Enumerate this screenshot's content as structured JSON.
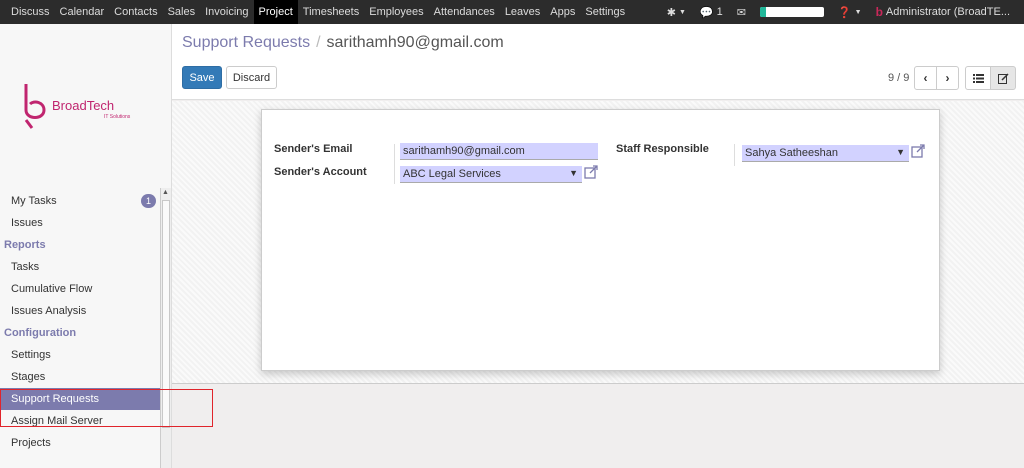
{
  "topbar": {
    "menu": [
      "Discuss",
      "Calendar",
      "Contacts",
      "Sales",
      "Invoicing",
      "Project",
      "Timesheets",
      "Employees",
      "Attendances",
      "Leaves",
      "Apps",
      "Settings"
    ],
    "active_menu": "Project",
    "messages_count": "1",
    "progress": 1.0,
    "user": "Administrator (BroadTE..."
  },
  "sidebar": {
    "brand_name": "BroadTech",
    "brand_sub": "IT Solutions",
    "my_tasks": "My Tasks",
    "my_tasks_badge": "1",
    "issues": "Issues",
    "reports_heading": "Reports",
    "tasks": "Tasks",
    "cumulative_flow": "Cumulative Flow",
    "issues_analysis": "Issues Analysis",
    "configuration_heading": "Configuration",
    "settings": "Settings",
    "stages": "Stages",
    "support_requests": "Support Requests",
    "assign_mail_server": "Assign Mail Server",
    "projects": "Projects"
  },
  "breadcrumb": {
    "parent": "Support Requests",
    "separator": "/",
    "current": "sarithamh90@gmail.com"
  },
  "buttons": {
    "save": "Save",
    "discard": "Discard"
  },
  "pager": {
    "value": "9 / 9"
  },
  "form": {
    "sender_email_label": "Sender's Email",
    "sender_email_value": "sarithamh90@gmail.com",
    "sender_account_label": "Sender's Account",
    "sender_account_value": "ABC Legal Services",
    "staff_responsible_label": "Staff Responsible",
    "staff_responsible_value": "Sahya Satheeshan"
  },
  "colors": {
    "accent": "#7c7bad",
    "primary_button": "#337ab7",
    "field_bg": "#d2d2ff",
    "highlight_box": "#e0242b"
  }
}
